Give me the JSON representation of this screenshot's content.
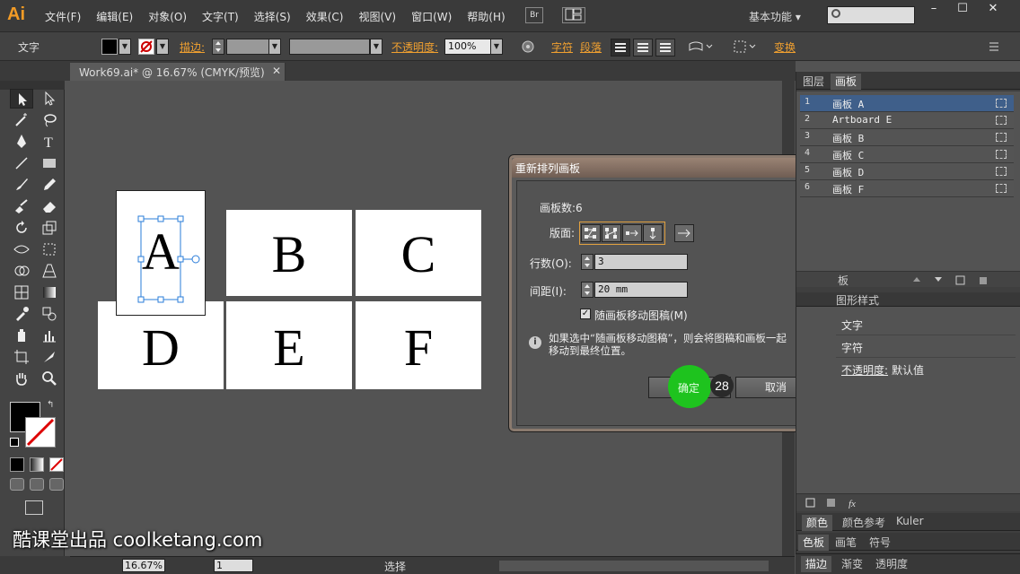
{
  "app": {
    "logo": "Ai",
    "menus": [
      "文件(F)",
      "编辑(E)",
      "对象(O)",
      "文字(T)",
      "选择(S)",
      "效果(C)",
      "视图(V)",
      "窗口(W)",
      "帮助(H)"
    ],
    "bridge_label": "Br",
    "workspace": "基本功能 ▾",
    "window_buttons": [
      "–",
      "☐",
      "✕"
    ]
  },
  "control": {
    "mode": "文字",
    "stroke_label": "描边:",
    "opacity_label": "不透明度:",
    "opacity_value": "100%",
    "char_label": "字符",
    "para_label": "段落",
    "transform_label": "变换"
  },
  "document": {
    "tab_title": "Work69.ai* @ 16.67% (CMYK/预览)",
    "close": "✕"
  },
  "artboards": [
    "A",
    "B",
    "C",
    "D",
    "E",
    "F"
  ],
  "dialog": {
    "title": "重新排列画板",
    "count_label": "画板数:6",
    "layout_label": "版面:",
    "rows_label": "行数(O):",
    "rows_value": "3",
    "spacing_label": "间距(I):",
    "spacing_value": "20 mm",
    "move_artwork_label": "随画板移动图稿(M)",
    "move_artwork_checked": "✓",
    "info_icon": "i",
    "info_text_line1": "如果选中“随画板移动图稿”，则会将图稿和画板一起",
    "info_text_line2": "移动到最终位置。",
    "ok_label": "确定",
    "cancel_label": "取消",
    "step_number": "28"
  },
  "panels": {
    "top_tabs": [
      "图层",
      "画板"
    ],
    "artboard_list": [
      {
        "num": "1",
        "name": "画板 A"
      },
      {
        "num": "2",
        "name": "Artboard E"
      },
      {
        "num": "3",
        "name": "画板 B"
      },
      {
        "num": "4",
        "name": "画板 C"
      },
      {
        "num": "5",
        "name": "画板 D"
      },
      {
        "num": "6",
        "name": "画板 F"
      }
    ],
    "mid_tab_partial": "板",
    "graphic_styles_tab": "图形样式",
    "appearance_title": "文字",
    "appearance_rows": [
      "字符"
    ],
    "appearance_opacity_label": "不透明度:",
    "appearance_opacity_value": "默认值",
    "color_tabs": [
      "颜色",
      "颜色参考",
      "Kuler"
    ],
    "swatch_tabs": [
      "色板",
      "画笔",
      "符号"
    ],
    "stroke_tabs": [
      "描边",
      "渐变",
      "透明度"
    ]
  },
  "status": {
    "zoom": "16.67%",
    "page": "1",
    "tool": "选择"
  },
  "watermark": "酷课堂出品 coolketang.com",
  "colors": {
    "accent_orange": "#f0a030",
    "selection_blue": "#3f5f8a",
    "click_green": "#1ec31e"
  }
}
